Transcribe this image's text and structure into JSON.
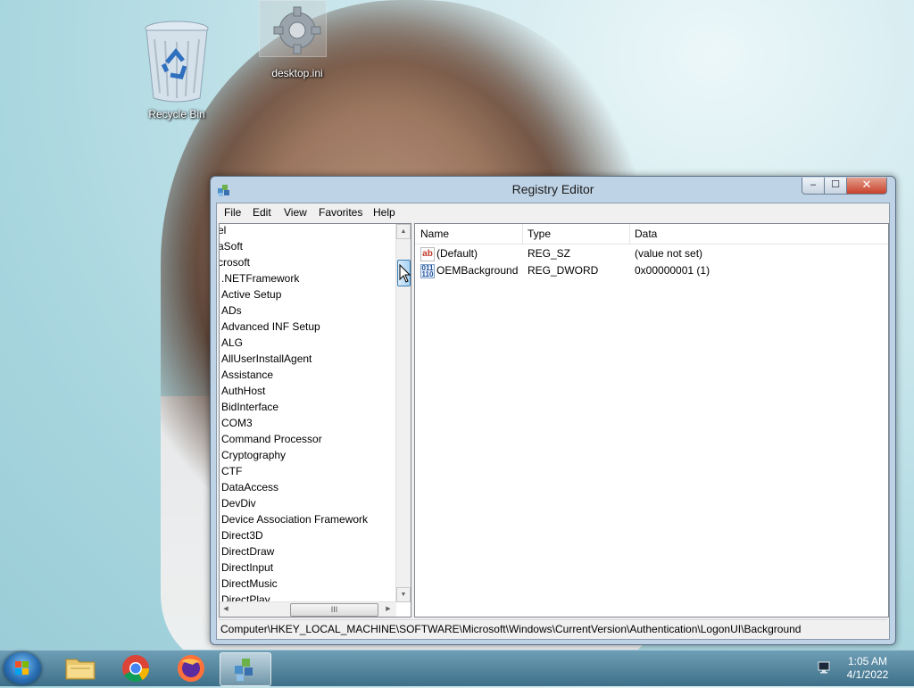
{
  "desktop": {
    "icons": [
      {
        "label": "desktop.ini"
      },
      {
        "label": "Recycle Bin"
      }
    ]
  },
  "window": {
    "title": "Registry Editor",
    "caption_buttons": {
      "minimize": "–",
      "maximize": "☐",
      "close": "✕"
    },
    "menu": [
      "File",
      "Edit",
      "View",
      "Favorites",
      "Help"
    ],
    "tree": {
      "items": [
        "el",
        "aSoft",
        "crosoft",
        ".NETFramework",
        "Active Setup",
        "ADs",
        "Advanced INF Setup",
        "ALG",
        "AllUserInstallAgent",
        "Assistance",
        "AuthHost",
        "BidInterface",
        "COM3",
        "Command Processor",
        "Cryptography",
        "CTF",
        "DataAccess",
        "DevDiv",
        "Device Association Framework",
        "Direct3D",
        "DirectDraw",
        "DirectInput",
        "DirectMusic",
        "DirectPlay"
      ],
      "hscroll_grip": "III"
    },
    "list": {
      "columns": [
        "Name",
        "Type",
        "Data"
      ],
      "rows": [
        {
          "icon": "ab",
          "name": "(Default)",
          "type": "REG_SZ",
          "data": "(value not set)"
        },
        {
          "icon": "bin",
          "name": "OEMBackground",
          "type": "REG_DWORD",
          "data": "0x00000001 (1)"
        }
      ]
    },
    "status_path": "Computer\\HKEY_LOCAL_MACHINE\\SOFTWARE\\Microsoft\\Windows\\CurrentVersion\\Authentication\\LogonUI\\Background"
  },
  "taskbar": {
    "items": [
      "start-orb",
      "file-explorer",
      "chrome",
      "firefox",
      "registry-editor"
    ],
    "clock": {
      "time": "1:05 AM",
      "date": "4/1/2022"
    }
  }
}
